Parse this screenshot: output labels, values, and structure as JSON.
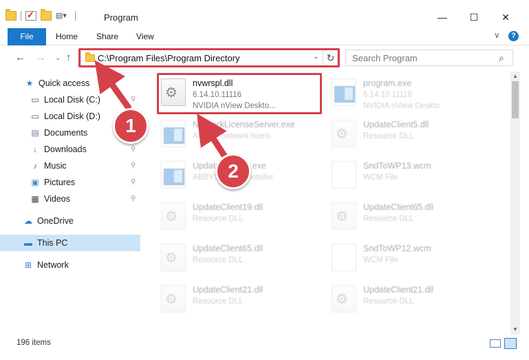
{
  "window": {
    "title": "Program",
    "controls": {
      "minimize": "—",
      "maximize": "☐",
      "close": "✕"
    }
  },
  "ribbon": {
    "tabs": [
      "File",
      "Home",
      "Share",
      "View"
    ],
    "collapse": "∨",
    "help": "?"
  },
  "nav": {
    "back": "←",
    "forward": "→",
    "recent": "⌄",
    "up": "↑",
    "address": "C:\\Program Files\\Program Directory",
    "address_dropdown": "⌄",
    "refresh": "↻",
    "search_placeholder": "Search Program",
    "search_icon": "⌕"
  },
  "sidebar": {
    "items": [
      {
        "label": "Quick access",
        "icon": "star-icon",
        "glyph": "★",
        "color": "#2b7cd3",
        "pinned": false,
        "selected": false
      },
      {
        "label": "Local Disk (C:)",
        "icon": "drive-icon",
        "glyph": "▭",
        "color": "#555555",
        "pinned": true,
        "selected": false
      },
      {
        "label": "Local Disk (D:)",
        "icon": "drive-icon",
        "glyph": "▭",
        "color": "#555555",
        "pinned": false,
        "selected": false
      },
      {
        "label": "Documents",
        "icon": "documents-icon",
        "glyph": "▤",
        "color": "#6a7f99",
        "pinned": true,
        "selected": false
      },
      {
        "label": "Downloads",
        "icon": "downloads-icon",
        "glyph": "↓",
        "color": "#2b7cd3",
        "pinned": true,
        "selected": false
      },
      {
        "label": "Music",
        "icon": "music-icon",
        "glyph": "♪",
        "color": "#2b7cd3",
        "pinned": true,
        "selected": false
      },
      {
        "label": "Pictures",
        "icon": "pictures-icon",
        "glyph": "▣",
        "color": "#4a8bc2",
        "pinned": true,
        "selected": false
      },
      {
        "label": "Videos",
        "icon": "videos-icon",
        "glyph": "▦",
        "color": "#444444",
        "pinned": true,
        "selected": false
      },
      {
        "label": "OneDrive",
        "icon": "cloud-icon",
        "glyph": "☁",
        "color": "#2b7cd3",
        "pinned": false,
        "selected": false
      },
      {
        "label": "This PC",
        "icon": "computer-icon",
        "glyph": "▬",
        "color": "#2b7cd3",
        "pinned": false,
        "selected": true
      },
      {
        "label": "Network",
        "icon": "network-icon",
        "glyph": "⊞",
        "color": "#2b7cd3",
        "pinned": false,
        "selected": false
      }
    ],
    "pin_glyph": "📌"
  },
  "files": [
    {
      "name": "nvwrspl.dll",
      "line2": "6.14.10.11116",
      "line3": "NVIDIA nView Deskto...",
      "icon": "dll",
      "faded": false,
      "highlighted": true
    },
    {
      "name": "program.exe",
      "line2": "6.14.10.11116",
      "line3": "NVIDIA nView Deskto",
      "icon": "exe",
      "faded": true,
      "highlighted": false
    },
    {
      "name": "NetworkLicenseServer.exe",
      "line2": "ABBYY network licens",
      "line3": "",
      "icon": "exe",
      "faded": true,
      "highlighted": false
    },
    {
      "name": "UpdateClient5.dll",
      "line2": "Resource DLL",
      "line3": "",
      "icon": "dll",
      "faded": true,
      "highlighted": false
    },
    {
      "name": "UpdateInstaller.exe",
      "line2": "ABBYY Online installer",
      "line3": "",
      "icon": "exe",
      "faded": true,
      "highlighted": false
    },
    {
      "name": "SndToWP13.wcm",
      "line2": "WCM File",
      "line3": "",
      "icon": "doc",
      "faded": true,
      "highlighted": false
    },
    {
      "name": "UpdateClient19.dll",
      "line2": "Resource DLL",
      "line3": "",
      "icon": "dll",
      "faded": true,
      "highlighted": false
    },
    {
      "name": "UpdateClient65.dll",
      "line2": "Resource DLL",
      "line3": "",
      "icon": "dll",
      "faded": true,
      "highlighted": false
    },
    {
      "name": "UpdateClient65.dll",
      "line2": "Resource DLL",
      "line3": "",
      "icon": "dll",
      "faded": true,
      "highlighted": false
    },
    {
      "name": "SndToWP12.wcm",
      "line2": "WCM File",
      "line3": "",
      "icon": "doc",
      "faded": true,
      "highlighted": false
    },
    {
      "name": "UpdateClient21.dll",
      "line2": "Resource DLL",
      "line3": "",
      "icon": "dll",
      "faded": true,
      "highlighted": false
    },
    {
      "name": "UpdateClient21.dll",
      "line2": "Resource DLL",
      "line3": "",
      "icon": "dll",
      "faded": true,
      "highlighted": false
    }
  ],
  "status": {
    "item_count": "196 items"
  },
  "callouts": [
    {
      "label": "1"
    },
    {
      "label": "2"
    }
  ],
  "colors": {
    "accent": "#1979ca",
    "highlight": "#d5404a",
    "selected_bg": "#cce4f7"
  }
}
